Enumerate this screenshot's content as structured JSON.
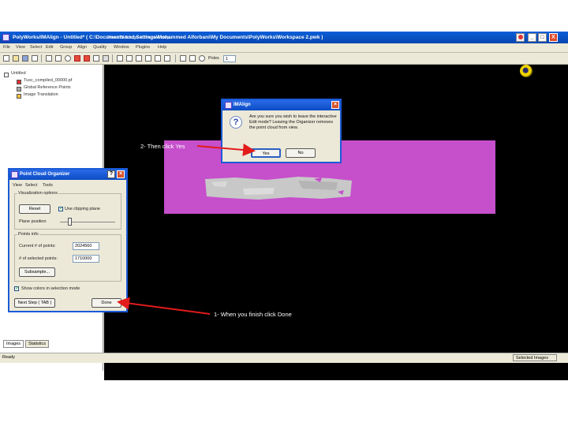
{
  "window": {
    "title": "PolyWorks/IMAlign - Untitled* ( C:\\Documents and Settings\\Mohammed Alforbani\\My Documents\\PolyWorks\\Workspace 2.pwk )",
    "minimize": "_",
    "maximize": "□",
    "close": "X"
  },
  "menu": [
    "File",
    "View",
    "Select",
    "Edit",
    "Group",
    "Align",
    "Quality",
    "Window",
    "Plugins",
    "Help"
  ],
  "toolbar": {
    "poles_label": "Poles",
    "poles_value": "1"
  },
  "tree": {
    "root": "Untitled",
    "items": [
      "Tusc_compiled_00000.pf",
      "Global Reference Points",
      "Image Translation"
    ]
  },
  "bottom_tabs": [
    "Images",
    "Statistics"
  ],
  "view": {
    "hint": "Press TAB to go to the next step."
  },
  "imalign_dialog": {
    "title": "IMAlign",
    "message": "Are you sure you wish to leave the interactive Edit mode? Leaving the Organizer removes the point cloud from view.",
    "yes": "Yes",
    "no": "No"
  },
  "organizer": {
    "title": "Point Cloud Organizer",
    "help": "?",
    "menu": [
      "View",
      "Select",
      "Tools"
    ],
    "group_view": "Visualization options",
    "reset_button": "Reset",
    "use_clipping_label": "Use clipping plane",
    "use_clipping_checked": true,
    "plane_position_label": "Plane position",
    "group_points": "Points info",
    "current_points_label": "Current # of points:",
    "current_points_value": "2024560",
    "selected_points_label": "# of selected points:",
    "selected_points_value": "1710000",
    "subsample_button": "Subsample...",
    "show_colors_label": "Show colors in selection mode",
    "show_colors_checked": true,
    "next_step_button": "Next Step ( TAB )",
    "done_button": "Done"
  },
  "status": {
    "left": "Ready",
    "right": "Selected Images"
  },
  "annotations": {
    "step2": "2- Then click Yes",
    "step1": "1- When you finish click Done"
  }
}
